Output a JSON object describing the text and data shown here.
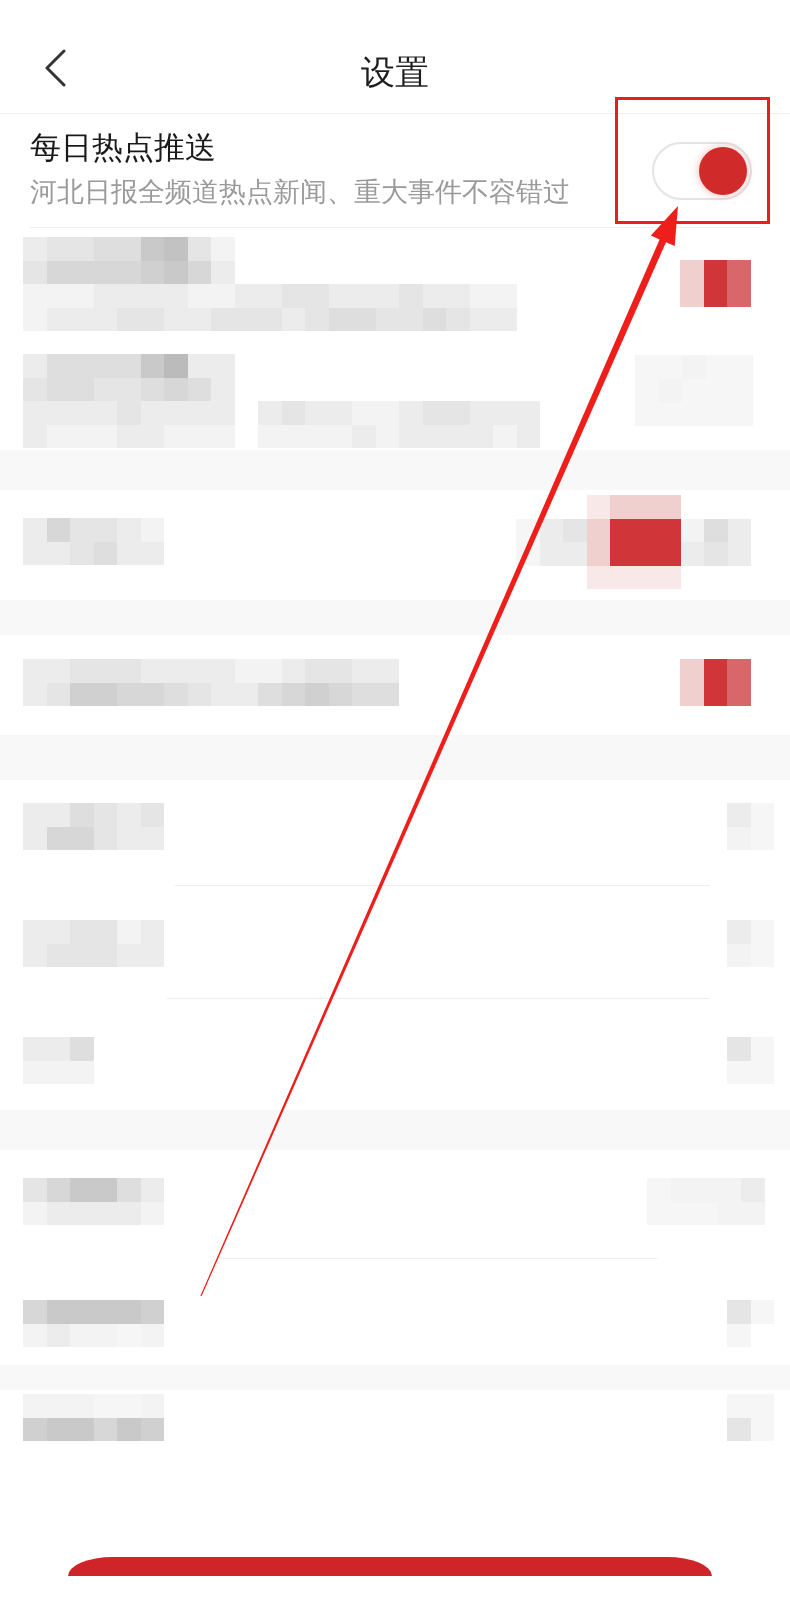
{
  "header": {
    "title": "设置"
  },
  "settings": [
    {
      "title": "每日热点推送",
      "description": "河北日报全频道热点新闻、重大事件不容错过",
      "on": true
    }
  ]
}
